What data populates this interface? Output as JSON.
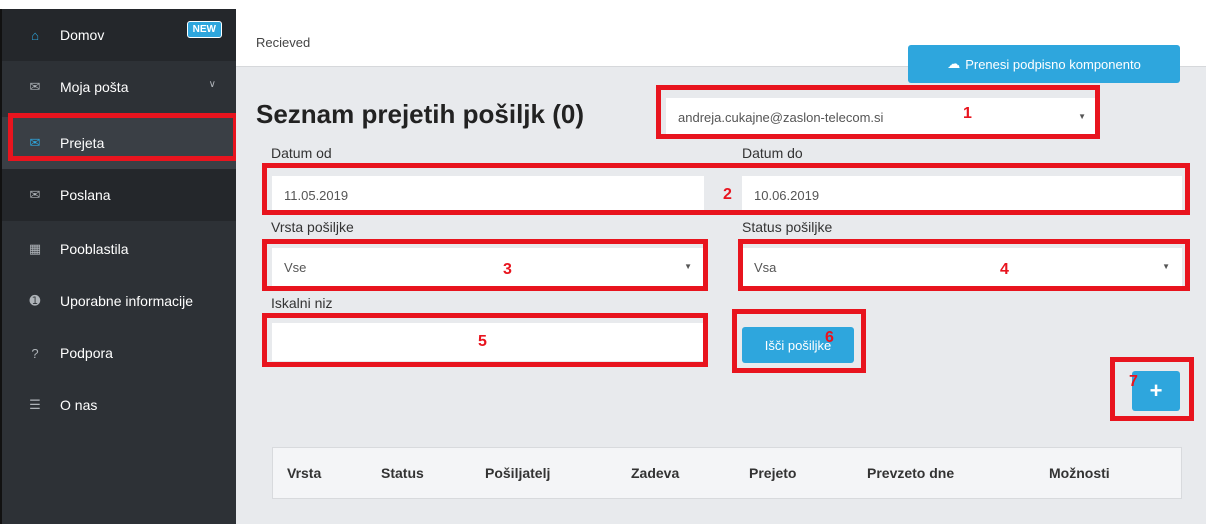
{
  "sidebar": {
    "items": [
      {
        "label": "Domov",
        "icon": "home-icon",
        "badge": "NEW"
      },
      {
        "label": "Moja pošta",
        "icon": "envelope-icon"
      },
      {
        "label": "Prejeta",
        "icon": "envelope-icon"
      },
      {
        "label": "Poslana",
        "icon": "envelope-icon"
      },
      {
        "label": "Pooblastila",
        "icon": "id-card-icon"
      },
      {
        "label": "Uporabne informacije",
        "icon": "info-icon"
      },
      {
        "label": "Podpora",
        "icon": "question-icon"
      },
      {
        "label": "O nas",
        "icon": "barcode-icon"
      }
    ]
  },
  "header": {
    "breadcrumb": "Recieved",
    "download_button": "Prenesi podpisno komponento"
  },
  "main": {
    "title": "Seznam prejetih pošiljk (0)",
    "account_select": "andreja.cukajne@zaslon-telecom.si",
    "date_from_label": "Datum od",
    "date_from_value": "11.05.2019",
    "date_to_label": "Datum do",
    "date_to_value": "10.06.2019",
    "type_label": "Vrsta pošiljke",
    "type_value": "Vse",
    "status_label": "Status pošiljke",
    "status_value": "Vsa",
    "search_label": "Iskalni niz",
    "search_value": "",
    "search_button": "Išči pošiljke",
    "add_button": "+"
  },
  "annotations": [
    "1",
    "2",
    "3",
    "4",
    "5",
    "6",
    "7"
  ],
  "table": {
    "columns": [
      "Vrsta",
      "Status",
      "Pošiljatelj",
      "Zadeva",
      "Prejeto",
      "Prevzeto dne",
      "Možnosti"
    ]
  },
  "colors": {
    "accent": "#2ea6dd",
    "sidebar": "#2d3136",
    "annotation_red": "#e8141e"
  }
}
